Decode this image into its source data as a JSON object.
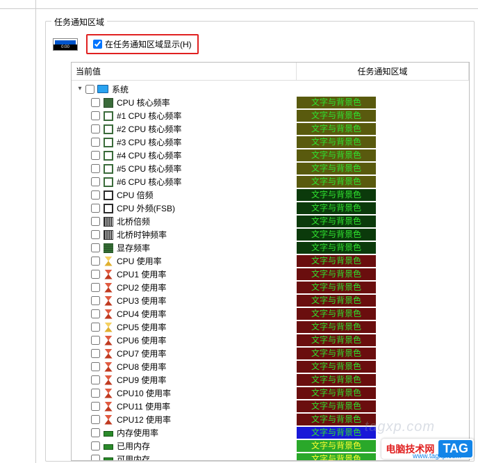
{
  "fieldset_title": "任务通知区域",
  "show_in_tray_label": "在任务通知区域显示(H)",
  "show_in_tray_checked": true,
  "columns": {
    "current": "当前值",
    "tray": "任务通知区域"
  },
  "root": {
    "label": "系统",
    "expanded": true,
    "checked": false
  },
  "badge_txt": "文字与背景色",
  "items": [
    {
      "label": "CPU 核心频率",
      "icon": "chip",
      "bg": "#595a0e",
      "fg": "#2fe22f"
    },
    {
      "label": "#1 CPU 核心频率",
      "icon": "chip-outline",
      "bg": "#595a0e",
      "fg": "#2fe22f"
    },
    {
      "label": "#2 CPU 核心频率",
      "icon": "chip-outline",
      "bg": "#595a0e",
      "fg": "#2fe22f"
    },
    {
      "label": "#3 CPU 核心频率",
      "icon": "chip-outline",
      "bg": "#595a0e",
      "fg": "#2fe22f"
    },
    {
      "label": "#4 CPU 核心频率",
      "icon": "chip-outline",
      "bg": "#595a0e",
      "fg": "#2fe22f"
    },
    {
      "label": "#5 CPU 核心频率",
      "icon": "chip-outline",
      "bg": "#595a0e",
      "fg": "#2fe22f"
    },
    {
      "label": "#6 CPU 核心频率",
      "icon": "chip-outline",
      "bg": "#595a0e",
      "fg": "#2fe22f"
    },
    {
      "label": "CPU 倍频",
      "icon": "chip2",
      "bg": "#0b3a0b",
      "fg": "#2fe22f"
    },
    {
      "label": "CPU 外频(FSB)",
      "icon": "chip2",
      "bg": "#0b3a0b",
      "fg": "#2fe22f"
    },
    {
      "label": "北桥倍频",
      "icon": "bars",
      "bg": "#0b3a0b",
      "fg": "#2fe22f"
    },
    {
      "label": "北桥时钟频率",
      "icon": "bars",
      "bg": "#0b3a0b",
      "fg": "#2fe22f"
    },
    {
      "label": "显存频率",
      "icon": "mem",
      "bg": "#0b3a0b",
      "fg": "#2fe22f"
    },
    {
      "label": "CPU 使用率",
      "icon": "hour-y",
      "bg": "#6a0e0e",
      "fg": "#2fe22f"
    },
    {
      "label": "CPU1 使用率",
      "icon": "hour-r",
      "bg": "#6a0e0e",
      "fg": "#2fe22f"
    },
    {
      "label": "CPU2 使用率",
      "icon": "hour-r",
      "bg": "#6a0e0e",
      "fg": "#2fe22f"
    },
    {
      "label": "CPU3 使用率",
      "icon": "hour-r",
      "bg": "#6a0e0e",
      "fg": "#2fe22f"
    },
    {
      "label": "CPU4 使用率",
      "icon": "hour-r",
      "bg": "#6a0e0e",
      "fg": "#2fe22f"
    },
    {
      "label": "CPU5 使用率",
      "icon": "hour-y",
      "bg": "#6a0e0e",
      "fg": "#2fe22f"
    },
    {
      "label": "CPU6 使用率",
      "icon": "hour-r",
      "bg": "#6a0e0e",
      "fg": "#2fe22f"
    },
    {
      "label": "CPU7 使用率",
      "icon": "hour-r",
      "bg": "#6a0e0e",
      "fg": "#2fe22f"
    },
    {
      "label": "CPU8 使用率",
      "icon": "hour-r",
      "bg": "#6a0e0e",
      "fg": "#2fe22f"
    },
    {
      "label": "CPU9 使用率",
      "icon": "hour-r",
      "bg": "#6a0e0e",
      "fg": "#2fe22f"
    },
    {
      "label": "CPU10 使用率",
      "icon": "hour-r",
      "bg": "#6a0e0e",
      "fg": "#2fe22f"
    },
    {
      "label": "CPU11 使用率",
      "icon": "hour-r",
      "bg": "#6a0e0e",
      "fg": "#2fe22f"
    },
    {
      "label": "CPU12 使用率",
      "icon": "hour-r",
      "bg": "#6a0e0e",
      "fg": "#2fe22f"
    },
    {
      "label": "内存使用率",
      "icon": "ram",
      "bg": "#1818d8",
      "fg": "#2fe22f"
    },
    {
      "label": "已用内存",
      "icon": "ram",
      "bg": "#2aa82a",
      "fg": "#ffff30"
    },
    {
      "label": "可用内存",
      "icon": "ram",
      "bg": "#2aa82a",
      "fg": "#ffff30"
    }
  ],
  "watermark": "tagxp.com",
  "badge": {
    "text": "电脑技术网",
    "tag": "TAG",
    "url": "www.tagxp.com"
  }
}
